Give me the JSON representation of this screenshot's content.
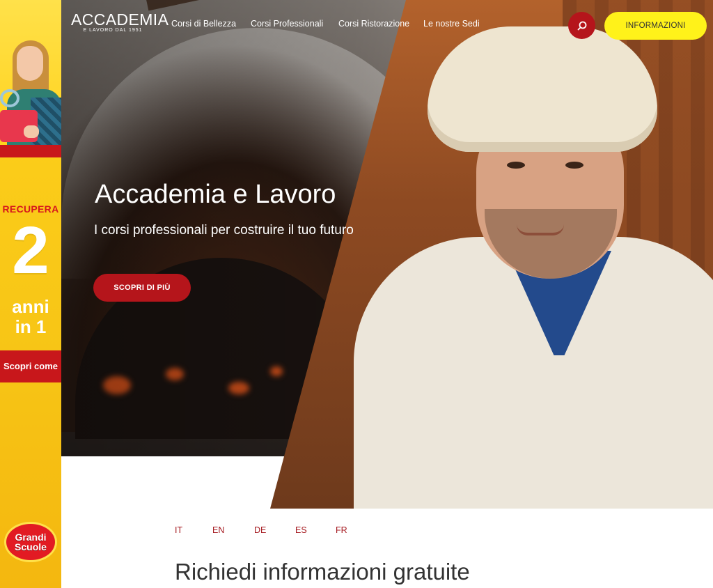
{
  "sidebar": {
    "recupera": "RECUPERA",
    "big_number": "2",
    "anni_line1": "anni",
    "anni_line2": "in 1",
    "cta": "Scopri come",
    "badge_line1": "Grandi",
    "badge_line2": "Scuole"
  },
  "nav": {
    "logo_title": "ACCADEMIA",
    "logo_sub": "E LAVORO DAL 1951",
    "links": [
      "Corsi di Bellezza",
      "Corsi Professionali",
      "Corsi Ristorazione",
      "Le nostre Sedi"
    ],
    "search_icon": "search-icon",
    "info_button": "INFORMAZIONI"
  },
  "hero": {
    "title": "Accademia e Lavoro",
    "subtitle": "I corsi professionali per costruire il tuo futuro",
    "cta": "SCOPRI DI PIÙ"
  },
  "languages": [
    "IT",
    "EN",
    "DE",
    "ES",
    "FR"
  ],
  "form": {
    "title": "Richiedi informazioni gratuite"
  },
  "colors": {
    "brand_red": "#b5151b",
    "info_yellow": "#fff21a",
    "sidebar_yellow": "#ffd21c"
  }
}
